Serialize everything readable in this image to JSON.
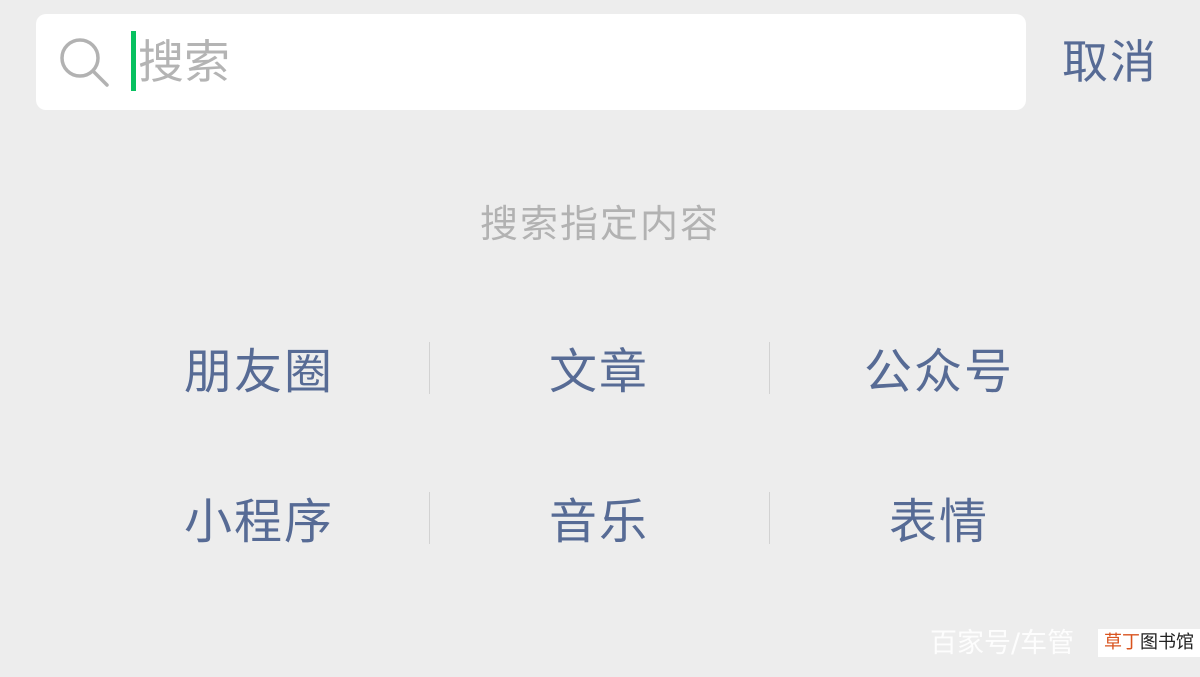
{
  "search": {
    "placeholder": "搜索",
    "value": "",
    "cancel_label": "取消"
  },
  "section_title": "搜索指定内容",
  "categories": [
    {
      "label": "朋友圈"
    },
    {
      "label": "文章"
    },
    {
      "label": "公众号"
    },
    {
      "label": "小程序"
    },
    {
      "label": "音乐"
    },
    {
      "label": "表情"
    }
  ],
  "watermark": {
    "text": "百家号/车管",
    "badge_accent": "草丁",
    "badge_rest": "图书馆"
  },
  "colors": {
    "background": "#ededed",
    "link": "#576b95",
    "cursor": "#07c160",
    "placeholder": "#b4b4b4"
  },
  "icons": {
    "search": "search-icon"
  }
}
